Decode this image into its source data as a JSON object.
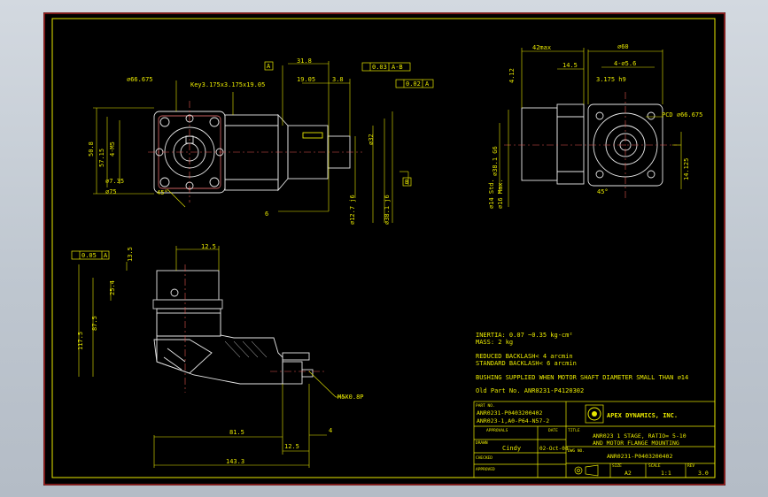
{
  "colors": {
    "background": "#000000",
    "viewport": "#c9d0d8",
    "border": "#d0302e",
    "outline": "#e6e6e6",
    "dimension": "#e8e800",
    "centerline": "#e4554e",
    "hatch": "#d8d8d8"
  },
  "sheet": {
    "left_view": {
      "diameter_label": "⌀66.675",
      "key_label": "Key3.175x3.175x19.05",
      "side_dims": [
        "50.8",
        "4-M5",
        "57.15"
      ],
      "small_dims": [
        "⌀7.35",
        "⌀75",
        "45°"
      ],
      "datum_a": "A",
      "dims_top": [
        "31.8",
        "19.05",
        "3.8"
      ],
      "fcf_1_val": "0.03",
      "fcf_1_ref": "A-B",
      "fcf_2_val": "0.02",
      "fcf_2_ref": "A",
      "shaft_dims": [
        "⌀12.7 j6",
        "⌀38.1 j6",
        "⌀32"
      ],
      "datum_b": "B",
      "dim_6": "6"
    },
    "right_view": {
      "dims_top": [
        "42max",
        "14.5",
        "⌀60",
        "4-⌀5.6",
        "3.175 h9"
      ],
      "dims_left": [
        "4.12",
        "⌀38.1 G6",
        "⌀14 Std.",
        "⌀16 Max."
      ],
      "pcd": "PCD ⌀66.675",
      "dim_right": "14.125",
      "angle": "45°"
    },
    "bottom_view": {
      "fcf_val": "0.05",
      "fcf_ref": "A",
      "dims": [
        "12.5",
        "13.5",
        "25.4",
        "87.5",
        "117.5",
        "81.5",
        "12.5",
        "4",
        "143.3"
      ],
      "thread": "M5X0.8P"
    },
    "notes": [
      "INERTIA:  0.07 ~0.35 kg-cm²",
      "MASS:  2  kg",
      "REDUCED BACKLASH< 4 arcmin",
      "STANDARD BACKLASH< 6 arcmin",
      "BUSHING SUPPLIED WHEN MOTOR SHAFT DIAMETER SMALL THAN ⌀14",
      "Old Part No. ANR0231-P4120302"
    ],
    "title_block": {
      "part_no_label": "PART NO.",
      "part_no_1": "ANR0231-P0403200402",
      "part_no_2": "ANR023-1,A0-P64-N57-2",
      "approval_label": "APPROVALS",
      "date_label": "DATE",
      "drawn_label": "DRAWN",
      "drawn_by": "Cindy",
      "drawn_date": "02-Oct-08",
      "checked_label": "CHECKED",
      "approved_label": "APPROVED",
      "company": "APEX DYNAMICS, INC.",
      "title_label": "TITLE",
      "title_1": "ANR023 1 STAGE, RATIO= 5-10",
      "title_2": "AND MOTOR FLANGE MOUNTING",
      "dwg_no_label": "DWG NO.",
      "dwg_no": "ANR0231-P0403200402",
      "size_label": "SIZE",
      "size": "A2",
      "scale_label": "SCALE",
      "scale": "1:1",
      "rev_label": "REV",
      "rev": "3.0"
    }
  }
}
